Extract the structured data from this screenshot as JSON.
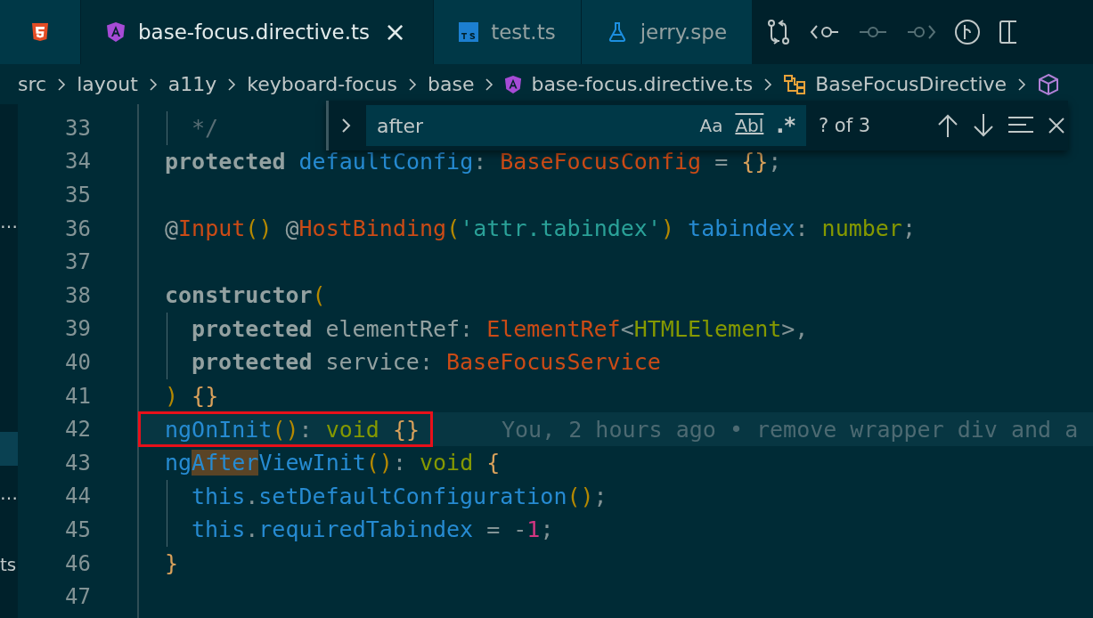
{
  "tabs": [
    {
      "kind": "html",
      "selected": false,
      "closable": false
    },
    {
      "kind": "angular",
      "label": "base-focus.directive.ts",
      "selected": true,
      "closable": true,
      "close": "×"
    },
    {
      "kind": "ts",
      "label": "test.ts",
      "selected": false,
      "closable": false
    },
    {
      "kind": "test",
      "label": "jerry.spe",
      "selected": false,
      "closable": false
    }
  ],
  "breadcrumbs": [
    {
      "kind": "folder",
      "label": "src"
    },
    {
      "kind": "folder",
      "label": "layout"
    },
    {
      "kind": "folder",
      "label": "a11y"
    },
    {
      "kind": "folder",
      "label": "keyboard-focus"
    },
    {
      "kind": "folder",
      "label": "base"
    },
    {
      "kind": "angular",
      "label": "base-focus.directive.ts"
    },
    {
      "kind": "class",
      "label": "BaseFocusDirective"
    },
    {
      "kind": "member"
    }
  ],
  "sidebar": [
    {
      "label": "…",
      "selected": false
    },
    {
      "selected": true
    },
    {
      "label": "…",
      "selected": false
    },
    {
      "label": "ts",
      "selected": false
    }
  ],
  "find": {
    "value": "after",
    "options": [
      "Aa",
      "Abl",
      ".*"
    ],
    "count": "? of 3"
  },
  "lines": [
    {
      "number": "33",
      "indented": true,
      "current": false,
      "tokens": [
        {
          "t": "*/",
          "kind": "comment"
        }
      ]
    },
    {
      "number": "34",
      "indented": false,
      "current": false,
      "tokens": [
        {
          "t": "protected",
          "kind": "kw"
        },
        {
          "t": " defaultConfig",
          "kind": "fn"
        },
        {
          "t": ": ",
          "kind": "punc"
        },
        {
          "t": "BaseFocusConfig",
          "kind": "type"
        },
        {
          "t": " = ",
          "kind": "punc"
        },
        {
          "t": "{}",
          "kind": "brace"
        },
        {
          "t": ";",
          "kind": "punc"
        }
      ]
    },
    {
      "number": "35",
      "indented": false,
      "current": false
    },
    {
      "number": "36",
      "indented": false,
      "current": false,
      "tokens": [
        {
          "t": "@",
          "kind": "plain"
        },
        {
          "t": "Input",
          "kind": "type"
        },
        {
          "t": "()",
          "kind": "paren"
        },
        {
          "t": " @",
          "kind": "plain"
        },
        {
          "t": "HostBinding",
          "kind": "type"
        },
        {
          "t": "(",
          "kind": "paren"
        },
        {
          "t": "'attr.tabindex'",
          "kind": "str"
        },
        {
          "t": ")",
          "kind": "paren"
        },
        {
          "t": " tabindex",
          "kind": "fn"
        },
        {
          "t": ": ",
          "kind": "punc"
        },
        {
          "t": "number",
          "kind": "void"
        },
        {
          "t": ";",
          "kind": "punc"
        }
      ]
    },
    {
      "number": "37",
      "indented": false,
      "current": false
    },
    {
      "number": "38",
      "indented": false,
      "current": false,
      "tokens": [
        {
          "t": "constructor",
          "kind": "kw"
        },
        {
          "t": "(",
          "kind": "paren"
        }
      ]
    },
    {
      "number": "39",
      "indented": true,
      "current": false,
      "tokens": [
        {
          "t": "protected",
          "kind": "kw"
        },
        {
          "t": " elementRef",
          "kind": "plain"
        },
        {
          "t": ": ",
          "kind": "punc"
        },
        {
          "t": "ElementRef",
          "kind": "type"
        },
        {
          "t": "<",
          "kind": "punc"
        },
        {
          "t": "HTMLElement",
          "kind": "void"
        },
        {
          "t": ">,",
          "kind": "punc"
        }
      ]
    },
    {
      "number": "40",
      "indented": true,
      "current": false,
      "tokens": [
        {
          "t": "protected",
          "kind": "kw"
        },
        {
          "t": " service",
          "kind": "plain"
        },
        {
          "t": ": ",
          "kind": "punc"
        },
        {
          "t": "BaseFocusService",
          "kind": "type"
        }
      ]
    },
    {
      "number": "41",
      "indented": false,
      "current": false,
      "tokens": [
        {
          "t": ")",
          "kind": "paren"
        },
        {
          "t": " {}",
          "kind": "brace"
        }
      ]
    },
    {
      "number": "42",
      "indented": false,
      "current": true,
      "boxed": true,
      "blame": "You, 2 hours ago • remove wrapper div and a",
      "tokens": [
        {
          "t": "ngOnInit",
          "kind": "fn"
        },
        {
          "t": "()",
          "kind": "paren"
        },
        {
          "t": ": ",
          "kind": "punc"
        },
        {
          "t": "void",
          "kind": "void"
        },
        {
          "t": " {}",
          "kind": "brace"
        }
      ]
    },
    {
      "number": "43",
      "indented": false,
      "current": false,
      "tokens": [
        {
          "t": "ng",
          "kind": "fn"
        },
        {
          "t": "After",
          "kind": "fn",
          "match": true
        },
        {
          "t": "ViewInit",
          "kind": "fn"
        },
        {
          "t": "()",
          "kind": "paren"
        },
        {
          "t": ": ",
          "kind": "punc"
        },
        {
          "t": "void",
          "kind": "void"
        },
        {
          "t": " {",
          "kind": "brace"
        }
      ]
    },
    {
      "number": "44",
      "indented": true,
      "current": false,
      "tokens": [
        {
          "t": "this",
          "kind": "fn"
        },
        {
          "t": ".",
          "kind": "punc"
        },
        {
          "t": "setDefaultConfiguration",
          "kind": "fn"
        },
        {
          "t": "()",
          "kind": "paren"
        },
        {
          "t": ";",
          "kind": "punc"
        }
      ]
    },
    {
      "number": "45",
      "indented": true,
      "current": false,
      "tokens": [
        {
          "t": "this",
          "kind": "fn"
        },
        {
          "t": ".",
          "kind": "punc"
        },
        {
          "t": "requiredTabindex",
          "kind": "fn"
        },
        {
          "t": " = -",
          "kind": "punc"
        },
        {
          "t": "1",
          "kind": "num"
        },
        {
          "t": ";",
          "kind": "punc"
        }
      ]
    },
    {
      "number": "46",
      "indented": false,
      "current": false,
      "tokens": [
        {
          "t": "}",
          "kind": "brace"
        }
      ]
    },
    {
      "number": "47",
      "indented": false,
      "current": false
    }
  ]
}
